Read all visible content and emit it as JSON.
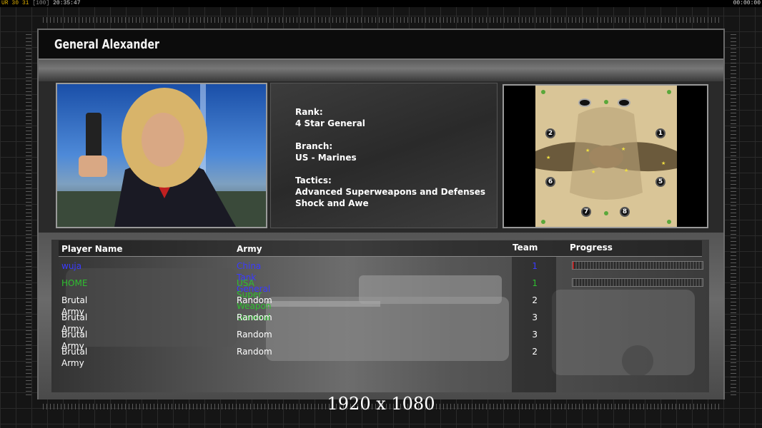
{
  "topbar": {
    "left_a": "UR",
    "left_b": "30",
    "left_c": "31",
    "left_d": "100",
    "clock": "20:35:47",
    "right_clock": "00:00:00"
  },
  "header": {
    "title": "General Alexander"
  },
  "general": {
    "rank_label": "Rank:",
    "rank_value": "4 Star General",
    "branch_label": "Branch:",
    "branch_value": "US - Marines",
    "tactics_label": "Tactics:",
    "tactics_line1": "Advanced Superweapons and Defenses",
    "tactics_line2": "Shock and Awe"
  },
  "map": {
    "slots": [
      "1",
      "2",
      "5",
      "6",
      "7",
      "8"
    ]
  },
  "table": {
    "headers": {
      "player": "Player Name",
      "army": "Army",
      "team": "Team",
      "progress": "Progress"
    },
    "rows": [
      {
        "player": "wuja",
        "army": "China Tank General",
        "team": "1",
        "color": "#3a3aff",
        "progress": 0.01,
        "has_bar": true
      },
      {
        "player": "HOME",
        "army": "USA Super Weapon General",
        "team": "1",
        "color": "#2fbf2f",
        "progress": 0.0,
        "has_bar": true
      },
      {
        "player": "Brutal Army",
        "army": "Random",
        "team": "2",
        "color": "#ffffff",
        "has_bar": false
      },
      {
        "player": "Brutal Army",
        "army": "Random",
        "team": "3",
        "color": "#ffffff",
        "has_bar": false
      },
      {
        "player": "Brutal Army",
        "army": "Random",
        "team": "3",
        "color": "#ffffff",
        "has_bar": false
      },
      {
        "player": "Brutal Army",
        "army": "Random",
        "team": "2",
        "color": "#ffffff",
        "has_bar": false
      }
    ]
  },
  "resolution_label": "1920 x 1080",
  "colors": {
    "player_blue": "#3a3aff",
    "player_green": "#2fbf2f",
    "progress_red": "#b02020"
  }
}
